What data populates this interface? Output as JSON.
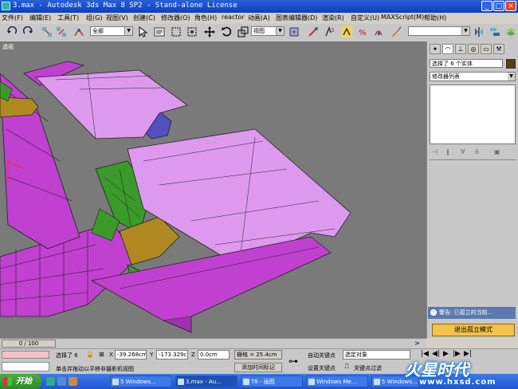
{
  "window": {
    "title": "3.max - Autodesk 3ds Max 8 SP2 - Stand-alone License"
  },
  "menu": [
    "文件(F)",
    "编辑(E)",
    "工具(T)",
    "组(G)",
    "视图(V)",
    "创建(C)",
    "修改器(O)",
    "reactor",
    "动画(A)",
    "图表编辑器(D)",
    "渲染(R)",
    "自定义(U)",
    "MAXScript(M)",
    "帮助(H)"
  ],
  "toolbar": {
    "selection_filter": "全部",
    "reference_coord": "视图"
  },
  "viewport": {
    "label": "透视"
  },
  "command_panel": {
    "selection_info": "选择了 6 个实体",
    "modifier_list": "修改器列表"
  },
  "warning": {
    "text": "警告: 已孤立的当前...",
    "exit_button": "退出孤立模式"
  },
  "timeline": {
    "frame": "0 / 100"
  },
  "status": {
    "selected": "选择了 6",
    "x_label": "X",
    "x_value": "-39.268cm",
    "y_label": "Y",
    "y_value": "-173.329c",
    "z_label": "Z",
    "z_value": "0.0cm",
    "grid": "栅格 = 25.4cm",
    "auto_key": "自动关键点",
    "key_filter": "选定对象",
    "set_key": "设置关键点",
    "key_filters": "关键点过滤",
    "prompt": "单击并拖动以平移非摄影机视图",
    "add_time_tag": "添加时间标记"
  },
  "taskbar": {
    "start": "开始",
    "tasks": [
      "5 Windows...",
      "3.max - Au...",
      "T8 - 画图",
      "Windows Me...",
      "5 Windows..."
    ]
  },
  "watermark": {
    "logo": "火星时代",
    "url": "www.hxsd.com"
  },
  "colors": {
    "title_blue": "#0a3fbf",
    "viewport_bg": "#7a7a7a",
    "object_pink": "#dd99ee",
    "object_magenta": "#c040d0",
    "propeller_green": "#3a9a2a",
    "spinner_gold": "#b08a20",
    "hub_blue": "#5050c0",
    "warning_blue": "#5b79b0",
    "exit_button_yellow": "#f3c24a"
  }
}
